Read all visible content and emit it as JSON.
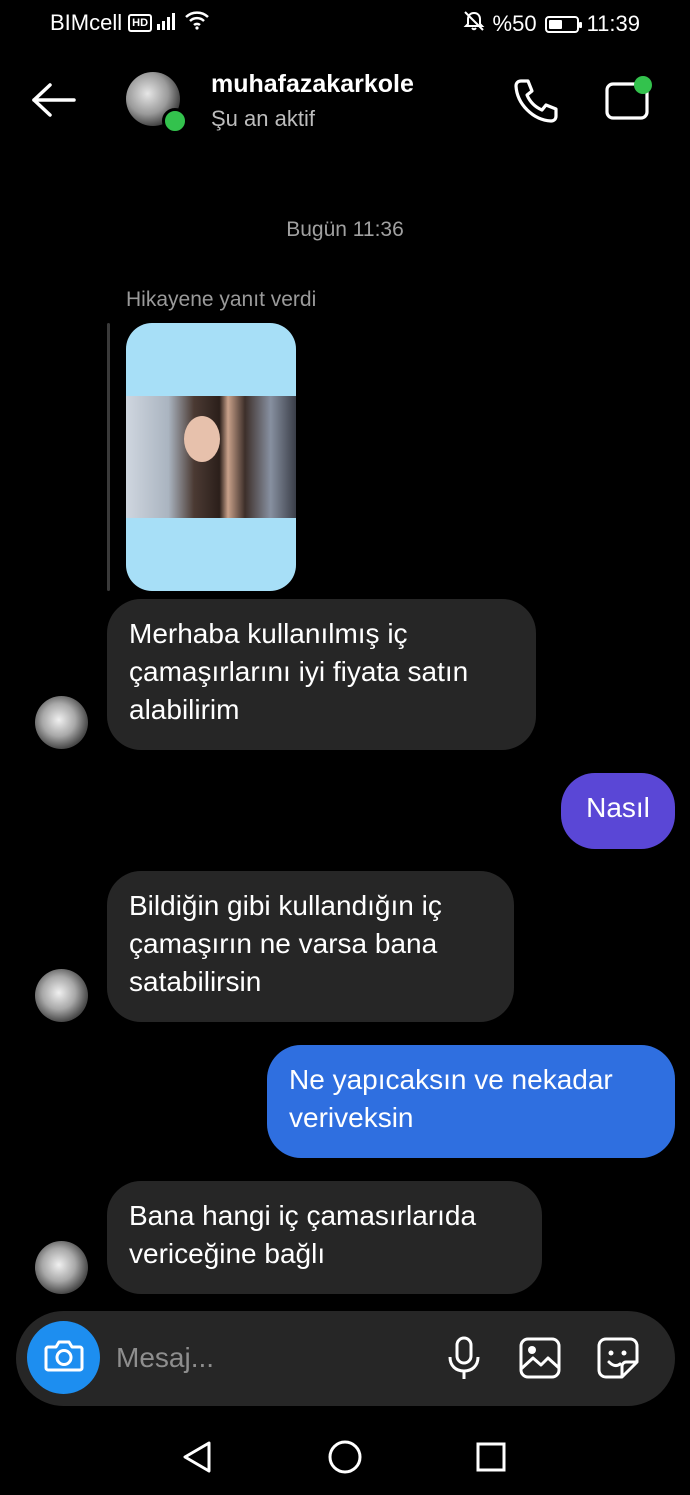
{
  "status_bar": {
    "carrier": "BIMcell",
    "hd_badge": "HD",
    "battery": "%50",
    "battery_level": 0.5,
    "time": "11:39",
    "icons": [
      "signal-icon",
      "wifi-icon",
      "mute-bell-icon",
      "battery-icon"
    ]
  },
  "header": {
    "back_icon": "back-arrow-icon",
    "username": "muhafazakarkole",
    "presence": "Şu an aktif",
    "call_icon": "phone-icon",
    "video_icon": "video-call-icon"
  },
  "chat": {
    "timestamp": "Bugün 11:36",
    "story_reply_caption": "Hikayene yanıt verdi",
    "messages": [
      {
        "from": "them",
        "text": "Merhaba kullanılmış iç çamaşırlarını iyi fiyata satın alabilirim"
      },
      {
        "from": "me",
        "text": "Nasıl"
      },
      {
        "from": "them",
        "text": "Bildiğin gibi kullandığın iç çamaşırın ne varsa bana satabilirsin"
      },
      {
        "from": "me",
        "text": "Ne yapıcaksın ve nekadar veriveksin"
      },
      {
        "from": "them",
        "text": "Bana hangi iç çamasırlarıda vericeğine bağlı"
      }
    ]
  },
  "composer": {
    "placeholder": "Mesaj...",
    "icons": [
      "camera-icon",
      "microphone-icon",
      "gallery-icon",
      "sticker-icon"
    ]
  },
  "nav_bar": {
    "icons": [
      "nav-back-icon",
      "nav-home-icon",
      "nav-recents-icon"
    ]
  },
  "colors": {
    "background": "#000000",
    "received_bubble": "#262626",
    "sent_bubble_purple": "#5a47d6",
    "sent_bubble_blue": "#2f6fe0",
    "camera_button": "#1d8ef0",
    "online": "#33c24d"
  }
}
